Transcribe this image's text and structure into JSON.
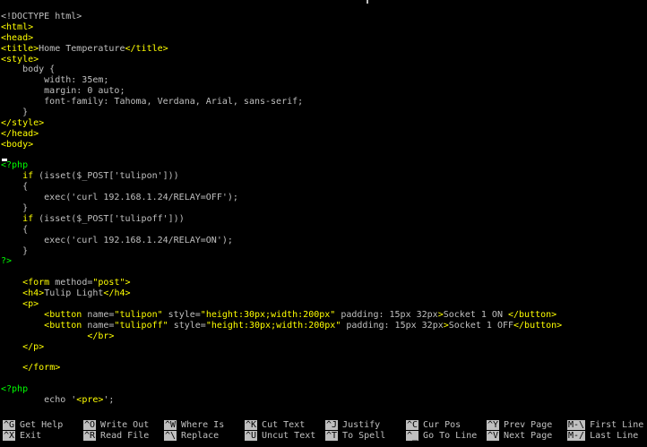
{
  "editor": {
    "lines": [
      [
        {
          "c": "txt",
          "t": "<!DOCTYPE html>"
        }
      ],
      [
        {
          "c": "tag",
          "t": "<html>"
        }
      ],
      [
        {
          "c": "tag",
          "t": "<head>"
        }
      ],
      [
        {
          "c": "tag",
          "t": "<title>"
        },
        {
          "c": "txt",
          "t": "Home Temperature"
        },
        {
          "c": "tag",
          "t": "</title>"
        }
      ],
      [
        {
          "c": "tag",
          "t": "<style>"
        }
      ],
      [
        {
          "c": "txt",
          "t": "    body {"
        }
      ],
      [
        {
          "c": "txt",
          "t": "        width: 35em;"
        }
      ],
      [
        {
          "c": "txt",
          "t": "        margin: 0 auto;"
        }
      ],
      [
        {
          "c": "txt",
          "t": "        font-family: Tahoma, Verdana, Arial, sans-serif;"
        }
      ],
      [
        {
          "c": "txt",
          "t": "    }"
        }
      ],
      [
        {
          "c": "tag",
          "t": "</style>"
        }
      ],
      [
        {
          "c": "tag",
          "t": "</head>"
        }
      ],
      [
        {
          "c": "tag",
          "t": "<body>"
        }
      ],
      [
        {
          "c": "txt",
          "t": ""
        }
      ],
      [
        {
          "c": "php",
          "t": "<?php"
        }
      ],
      [
        {
          "c": "txt",
          "t": "    "
        },
        {
          "c": "kw",
          "t": "if"
        },
        {
          "c": "txt",
          "t": " (isset($_POST['tulipon']))"
        }
      ],
      [
        {
          "c": "txt",
          "t": "    {"
        }
      ],
      [
        {
          "c": "txt",
          "t": "        exec('curl 192.168.1.24/RELAY=OFF');"
        }
      ],
      [
        {
          "c": "txt",
          "t": "    }"
        }
      ],
      [
        {
          "c": "txt",
          "t": "    "
        },
        {
          "c": "kw",
          "t": "if"
        },
        {
          "c": "txt",
          "t": " (isset($_POST['tulipoff']))"
        }
      ],
      [
        {
          "c": "txt",
          "t": "    {"
        }
      ],
      [
        {
          "c": "txt",
          "t": "        exec('curl 192.168.1.24/RELAY=ON');"
        }
      ],
      [
        {
          "c": "txt",
          "t": "    }"
        }
      ],
      [
        {
          "c": "php",
          "t": "?>"
        }
      ],
      [
        {
          "c": "txt",
          "t": ""
        }
      ],
      [
        {
          "c": "txt",
          "t": "    "
        },
        {
          "c": "tag",
          "t": "<form"
        },
        {
          "c": "txt",
          "t": " method="
        },
        {
          "c": "str",
          "t": "\"post\""
        },
        {
          "c": "tag",
          "t": ">"
        }
      ],
      [
        {
          "c": "txt",
          "t": "    "
        },
        {
          "c": "tag",
          "t": "<h4>"
        },
        {
          "c": "txt",
          "t": "Tulip Light"
        },
        {
          "c": "tag",
          "t": "</h4>"
        }
      ],
      [
        {
          "c": "txt",
          "t": "    "
        },
        {
          "c": "tag",
          "t": "<p>"
        }
      ],
      [
        {
          "c": "txt",
          "t": "        "
        },
        {
          "c": "tag",
          "t": "<button"
        },
        {
          "c": "txt",
          "t": " name="
        },
        {
          "c": "str",
          "t": "\"tulipon\""
        },
        {
          "c": "txt",
          "t": " style="
        },
        {
          "c": "str",
          "t": "\"height:30px;width:200px\""
        },
        {
          "c": "txt",
          "t": " padding: 15px 32px"
        },
        {
          "c": "tag",
          "t": ">"
        },
        {
          "c": "txt",
          "t": "Socket 1 ON "
        },
        {
          "c": "tag",
          "t": "</button>"
        }
      ],
      [
        {
          "c": "txt",
          "t": "        "
        },
        {
          "c": "tag",
          "t": "<button"
        },
        {
          "c": "txt",
          "t": " name="
        },
        {
          "c": "str",
          "t": "\"tulipoff\""
        },
        {
          "c": "txt",
          "t": " style="
        },
        {
          "c": "str",
          "t": "\"height:30px;width:200px\""
        },
        {
          "c": "txt",
          "t": " padding: 15px 32px"
        },
        {
          "c": "tag",
          "t": ">"
        },
        {
          "c": "txt",
          "t": "Socket 1 OFF"
        },
        {
          "c": "tag",
          "t": "</button>"
        }
      ],
      [
        {
          "c": "txt",
          "t": "                "
        },
        {
          "c": "tag",
          "t": "</br>"
        }
      ],
      [
        {
          "c": "txt",
          "t": "    "
        },
        {
          "c": "tag",
          "t": "</p>"
        }
      ],
      [
        {
          "c": "txt",
          "t": ""
        }
      ],
      [
        {
          "c": "txt",
          "t": "    "
        },
        {
          "c": "tag",
          "t": "</form>"
        }
      ],
      [
        {
          "c": "txt",
          "t": ""
        }
      ],
      [
        {
          "c": "php",
          "t": "<?php"
        }
      ],
      [
        {
          "c": "txt",
          "t": "        echo '"
        },
        {
          "c": "tag",
          "t": "<pre>"
        },
        {
          "c": "txt",
          "t": "';"
        }
      ]
    ]
  },
  "shortcuts": [
    {
      "key": "^G",
      "label": "Get Help",
      "col": 0,
      "row": 0
    },
    {
      "key": "^X",
      "label": "Exit",
      "col": 0,
      "row": 1
    },
    {
      "key": "^O",
      "label": "Write Out",
      "col": 1,
      "row": 0
    },
    {
      "key": "^R",
      "label": "Read File",
      "col": 1,
      "row": 1
    },
    {
      "key": "^W",
      "label": "Where Is",
      "col": 2,
      "row": 0
    },
    {
      "key": "^\\",
      "label": "Replace",
      "col": 2,
      "row": 1
    },
    {
      "key": "^K",
      "label": "Cut Text",
      "col": 3,
      "row": 0
    },
    {
      "key": "^U",
      "label": "Uncut Text",
      "col": 3,
      "row": 1
    },
    {
      "key": "^J",
      "label": "Justify",
      "col": 4,
      "row": 0
    },
    {
      "key": "^T",
      "label": "To Spell",
      "col": 4,
      "row": 1
    },
    {
      "key": "^C",
      "label": "Cur Pos",
      "col": 5,
      "row": 0
    },
    {
      "key": "^_",
      "label": "Go To Line",
      "col": 5,
      "row": 1
    },
    {
      "key": "^Y",
      "label": "Prev Page",
      "col": 6,
      "row": 0
    },
    {
      "key": "^V",
      "label": "Next Page",
      "col": 6,
      "row": 1
    },
    {
      "key": "M-\\",
      "label": "First Line",
      "col": 7,
      "row": 0
    },
    {
      "key": "M-/",
      "label": "Last Line",
      "col": 7,
      "row": 1
    }
  ],
  "colors": {
    "background": "#000000",
    "text": "#c0c0c0",
    "tag": "#ffff00",
    "php": "#00ff00"
  }
}
